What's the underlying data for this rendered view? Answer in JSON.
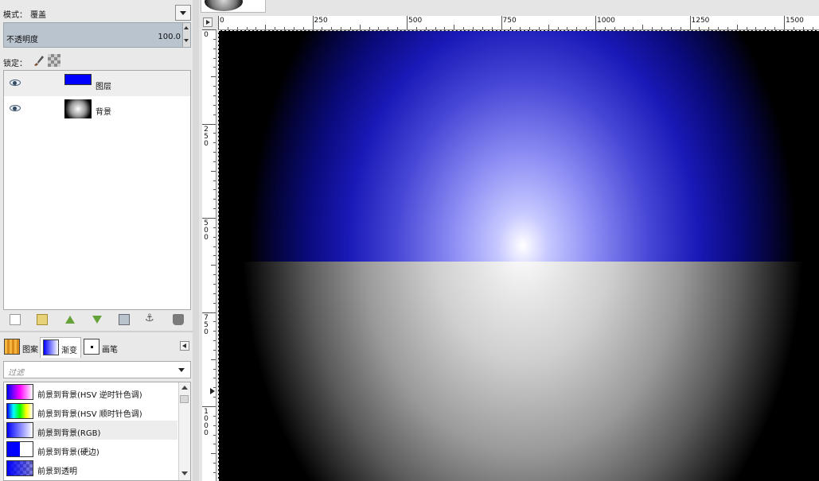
{
  "layers_panel": {
    "mode_label": "模式：",
    "mode_value": "覆盖",
    "opacity_label": "不透明度",
    "opacity_value": "100.0",
    "lock_label": "锁定：",
    "layers": [
      {
        "name": "图层",
        "visible": true,
        "selected": true
      },
      {
        "name": "背景",
        "visible": true,
        "selected": false
      }
    ]
  },
  "resource_tabs": {
    "tabs": [
      {
        "label": "图案"
      },
      {
        "label": "渐变",
        "active": true
      },
      {
        "label": "画笔"
      }
    ],
    "filter_placeholder": "过滤",
    "gradients": [
      {
        "name": "前景到背景(HSV 逆时针色调)"
      },
      {
        "name": "前景到背景(HSV 顺时针色调)"
      },
      {
        "name": "前景到背景(RGB)",
        "selected": true
      },
      {
        "name": "前景到背景(硬边)"
      },
      {
        "name": "前景到透明"
      }
    ]
  },
  "canvas": {
    "hruler_labels": [
      "0",
      "250",
      "500",
      "750",
      "1000",
      "1250",
      "1500"
    ],
    "vruler_labels": [
      "0",
      "250",
      "500",
      "750",
      "1000"
    ],
    "colors": {
      "foreground": "#0000ff",
      "background": "#ffffff"
    }
  }
}
